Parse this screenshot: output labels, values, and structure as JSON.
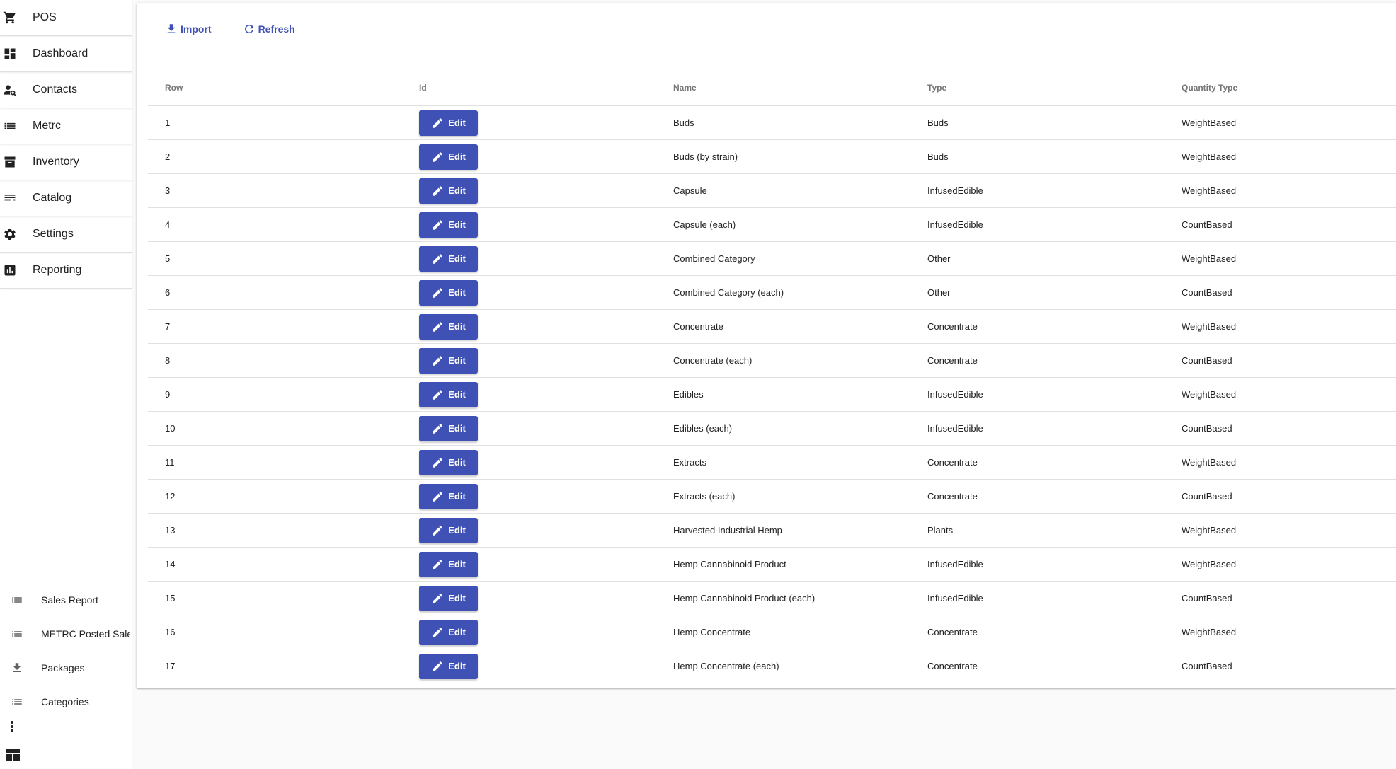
{
  "sidebar": {
    "nav": [
      {
        "label": "POS",
        "icon": "cart-icon"
      },
      {
        "label": "Dashboard",
        "icon": "dashboard-icon"
      },
      {
        "label": "Contacts",
        "icon": "contacts-icon"
      },
      {
        "label": "Metrc",
        "icon": "list-icon"
      },
      {
        "label": "Inventory",
        "icon": "archive-icon"
      },
      {
        "label": "Catalog",
        "icon": "catalog-icon"
      },
      {
        "label": "Settings",
        "icon": "gear-icon"
      },
      {
        "label": "Reporting",
        "icon": "chart-icon"
      }
    ],
    "sub": [
      {
        "label": "Sales Report",
        "icon": "list-icon"
      },
      {
        "label": "METRC Posted Sales",
        "icon": "list-icon"
      },
      {
        "label": "Packages",
        "icon": "download-icon"
      },
      {
        "label": "Categories",
        "icon": "list-icon"
      }
    ]
  },
  "toolbar": {
    "import_label": "Import",
    "refresh_label": "Refresh"
  },
  "table": {
    "headers": {
      "row": "Row",
      "id": "Id",
      "name": "Name",
      "type": "Type",
      "quantity_type": "Quantity Type"
    },
    "edit_label": "Edit",
    "rows": [
      {
        "row": "1",
        "name": "Buds",
        "type": "Buds",
        "quantity_type": "WeightBased"
      },
      {
        "row": "2",
        "name": "Buds (by strain)",
        "type": "Buds",
        "quantity_type": "WeightBased"
      },
      {
        "row": "3",
        "name": "Capsule",
        "type": "InfusedEdible",
        "quantity_type": "WeightBased"
      },
      {
        "row": "4",
        "name": "Capsule (each)",
        "type": "InfusedEdible",
        "quantity_type": "CountBased"
      },
      {
        "row": "5",
        "name": "Combined Category",
        "type": "Other",
        "quantity_type": "WeightBased"
      },
      {
        "row": "6",
        "name": "Combined Category (each)",
        "type": "Other",
        "quantity_type": "CountBased"
      },
      {
        "row": "7",
        "name": "Concentrate",
        "type": "Concentrate",
        "quantity_type": "WeightBased"
      },
      {
        "row": "8",
        "name": "Concentrate (each)",
        "type": "Concentrate",
        "quantity_type": "CountBased"
      },
      {
        "row": "9",
        "name": "Edibles",
        "type": "InfusedEdible",
        "quantity_type": "WeightBased"
      },
      {
        "row": "10",
        "name": "Edibles (each)",
        "type": "InfusedEdible",
        "quantity_type": "CountBased"
      },
      {
        "row": "11",
        "name": "Extracts",
        "type": "Concentrate",
        "quantity_type": "WeightBased"
      },
      {
        "row": "12",
        "name": "Extracts (each)",
        "type": "Concentrate",
        "quantity_type": "CountBased"
      },
      {
        "row": "13",
        "name": "Harvested Industrial Hemp",
        "type": "Plants",
        "quantity_type": "WeightBased"
      },
      {
        "row": "14",
        "name": "Hemp Cannabinoid Product",
        "type": "InfusedEdible",
        "quantity_type": "WeightBased"
      },
      {
        "row": "15",
        "name": "Hemp Cannabinoid Product (each)",
        "type": "InfusedEdible",
        "quantity_type": "CountBased"
      },
      {
        "row": "16",
        "name": "Hemp Concentrate",
        "type": "Concentrate",
        "quantity_type": "WeightBased"
      },
      {
        "row": "17",
        "name": "Hemp Concentrate (each)",
        "type": "Concentrate",
        "quantity_type": "CountBased"
      }
    ]
  },
  "colors": {
    "accent": "#3f51b5",
    "divider": "#e0e0e0",
    "background": "#fafafa"
  }
}
